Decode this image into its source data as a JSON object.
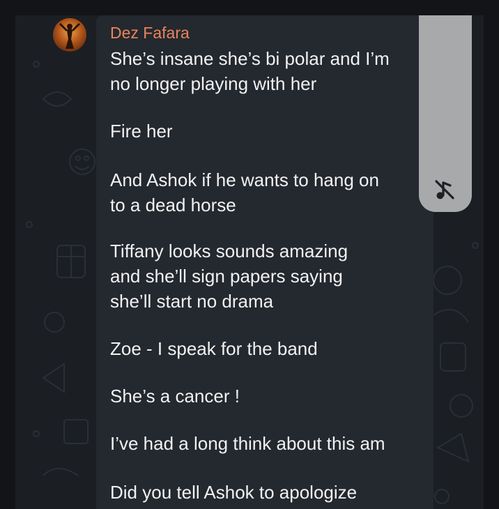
{
  "message": {
    "sender": "Dez Fafara",
    "lines": [
      "She’s insane she’s bi polar and I’m",
      "no longer playing with her",
      "Fire her",
      "And Ashok if he wants to hang on",
      "to a dead horse",
      "Tiffany looks sounds amazing",
      "and she’ll sign papers saying",
      "she’ll start no drama",
      "Zoe - I speak for the band",
      "She’s a cancer !",
      "I’ve had a long think about this am",
      "Did you tell Ashok to apologize"
    ]
  },
  "icons": {
    "avatar": "avatar-image",
    "overlay": "music-off-icon"
  },
  "colors": {
    "sender_name": "#e9855b",
    "bubble": "#24282f",
    "background": "#1b1f24",
    "text": "#f1f1f1"
  }
}
